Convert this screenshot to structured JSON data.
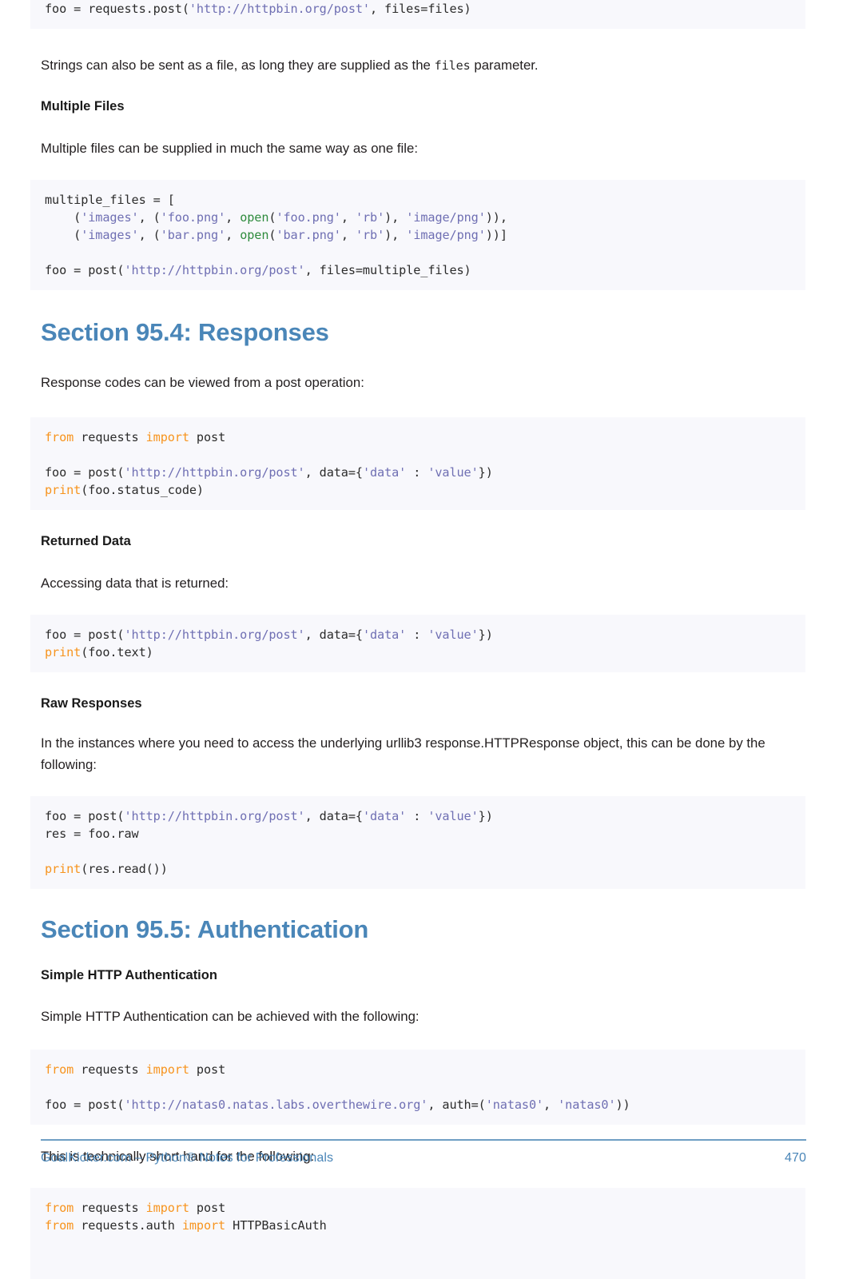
{
  "document": {
    "footer": {
      "left": "GoalKicker.com – Python® Notes for Professionals",
      "page_number": "470",
      "accent_color": "#4a86b8"
    },
    "code_colors": {
      "background": "#f8f8fc",
      "string": "#6f6fb3",
      "keyword": "#f7941e",
      "builtin": "#2e8b3d",
      "text": "#2b2b2b"
    }
  },
  "blocks": {
    "code_post_files": {
      "line1_a": "foo = requests.post(",
      "line1_url": "'http://httpbin.org/post'",
      "line1_b": ", files=files)"
    },
    "para_strings_file": {
      "part1": "Strings can also be sent as a file, as long they are supplied as the ",
      "code": "files",
      "part2": " parameter."
    },
    "heading_multiple_files": "Multiple Files",
    "para_multiple_files": "Multiple files can be supplied in much the same way as one file:",
    "code_multiple_files": {
      "l1": "multiple_files = [",
      "l2_a": "    (",
      "l2_s1": "'images'",
      "l2_b": ", (",
      "l2_s2": "'foo.png'",
      "l2_c": ", ",
      "l2_fn": "open",
      "l2_d": "(",
      "l2_s3": "'foo.png'",
      "l2_e": ", ",
      "l2_s4": "'rb'",
      "l2_f": "), ",
      "l2_s5": "'image/png'",
      "l2_g": ")),",
      "l3_a": "    (",
      "l3_s1": "'images'",
      "l3_b": ", (",
      "l3_s2": "'bar.png'",
      "l3_c": ", ",
      "l3_fn": "open",
      "l3_d": "(",
      "l3_s3": "'bar.png'",
      "l3_e": ", ",
      "l3_s4": "'rb'",
      "l3_f": "), ",
      "l3_s5": "'image/png'",
      "l3_g": "))]",
      "l5_a": "foo = post(",
      "l5_url": "'http://httpbin.org/post'",
      "l5_b": ", files=multiple_files)"
    },
    "section_responses": "Section 95.4: Responses",
    "para_response_codes": "Response codes can be viewed from a post operation:",
    "code_responses": {
      "l1_k1": "from",
      "l1_a": " requests ",
      "l1_k2": "import",
      "l1_b": " post",
      "l3_a": "foo = post(",
      "l3_url": "'http://httpbin.org/post'",
      "l3_b": ", data={",
      "l3_s1": "'data'",
      "l3_c": " : ",
      "l3_s2": "'value'",
      "l3_d": "})",
      "l4_k": "print",
      "l4_a": "(foo.status_code)"
    },
    "heading_returned_data": "Returned Data",
    "para_returned_data": "Accessing data that is returned:",
    "code_returned_data": {
      "l1_a": "foo = post(",
      "l1_url": "'http://httpbin.org/post'",
      "l1_b": ", data={",
      "l1_s1": "'data'",
      "l1_c": " : ",
      "l1_s2": "'value'",
      "l1_d": "})",
      "l2_k": "print",
      "l2_a": "(foo.text)"
    },
    "heading_raw_responses": "Raw Responses",
    "para_raw_responses": "In the instances where you need to access the underlying urllib3 response.HTTPResponse object, this can be done by the following:",
    "code_raw_responses": {
      "l1_a": "foo = post(",
      "l1_url": "'http://httpbin.org/post'",
      "l1_b": ", data={",
      "l1_s1": "'data'",
      "l1_c": " : ",
      "l1_s2": "'value'",
      "l1_d": "})",
      "l2": "res = foo.raw",
      "l4_k": "print",
      "l4_a": "(res.read())"
    },
    "section_authentication": "Section 95.5: Authentication",
    "heading_simple_http_auth": "Simple HTTP Authentication",
    "para_simple_http_auth": "Simple HTTP Authentication can be achieved with the following:",
    "code_simple_auth": {
      "l1_k1": "from",
      "l1_a": " requests ",
      "l1_k2": "import",
      "l1_b": " post",
      "l3_a": "foo = post(",
      "l3_url": "'http://natas0.natas.labs.overthewire.org'",
      "l3_b": ", auth=(",
      "l3_s1": "'natas0'",
      "l3_c": ", ",
      "l3_s2": "'natas0'",
      "l3_d": "))"
    },
    "para_short_hand": "This is technically short hand for the following:",
    "code_basic_auth": {
      "l1_k1": "from",
      "l1_a": " requests ",
      "l1_k2": "import",
      "l1_b": " post",
      "l2_k1": "from",
      "l2_a": " requests.auth ",
      "l2_k2": "import",
      "l2_b": " HTTPBasicAuth"
    }
  }
}
